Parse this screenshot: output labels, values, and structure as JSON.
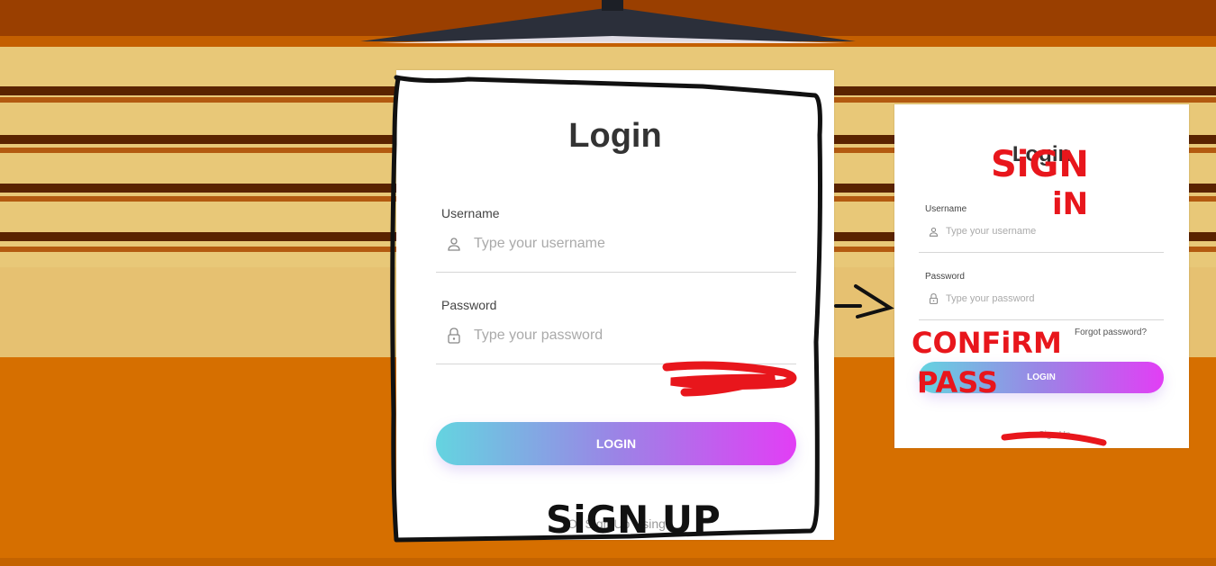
{
  "main_card": {
    "title": "Login",
    "username_label": "Username",
    "username_placeholder": "Type your username",
    "password_label": "Password",
    "password_placeholder": "Type your password",
    "login_button": "LOGIN",
    "bottom_text": "Or Sign Up Using"
  },
  "side_card": {
    "title": "Login",
    "username_label": "Username",
    "username_placeholder": "Type your username",
    "password_label": "Password",
    "password_placeholder": "Type your password",
    "forgot_text": "Forgot password?",
    "login_button": "LOGIN",
    "bottom_text": "Sign Up"
  },
  "annotations": {
    "sign_up": "SiGN UP",
    "sign_in_line1": "SiGN",
    "sign_in_line2": "iN",
    "confirm": "CONFiRM",
    "pass": "PASS",
    "arrow": "->"
  },
  "colors": {
    "annotation_black": "#111111",
    "annotation_red": "#e8161c",
    "button_gradient_start": "#64d4e0",
    "button_gradient_end": "#e23ef5"
  }
}
